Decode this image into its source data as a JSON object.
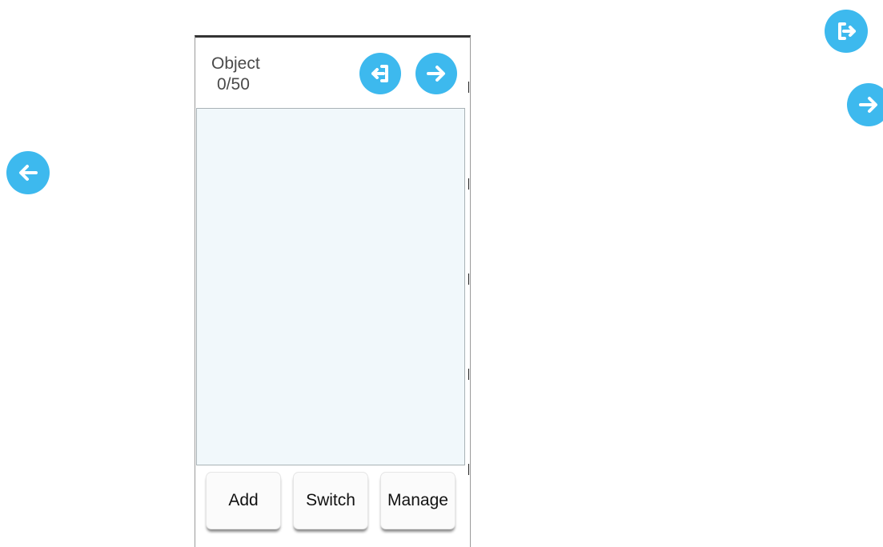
{
  "panel": {
    "title": "Object",
    "count": "0/50"
  },
  "icons": {
    "back": "arrow-left-icon",
    "exit": "exit-icon",
    "forward": "arrow-right-icon"
  },
  "buttons": {
    "add": "Add",
    "switch": "Switch",
    "manage": "Manage"
  },
  "colors": {
    "accent": "#3db9ee",
    "list_background": "#f1f8fb"
  }
}
